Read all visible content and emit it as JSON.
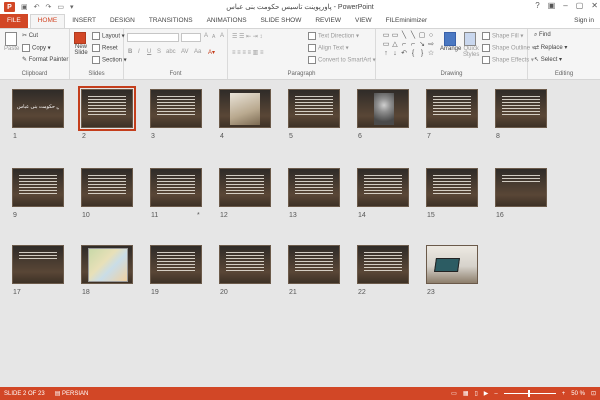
{
  "window": {
    "title": "پاورپوینت تاسیس حکومت بنی عباس - PowerPoint",
    "app_icon": "P",
    "controls": [
      "?",
      "▣",
      "–",
      "▢",
      "✕"
    ]
  },
  "ribbon_tabs": [
    {
      "label": "FILE"
    },
    {
      "label": "HOME"
    },
    {
      "label": "INSERT"
    },
    {
      "label": "DESIGN"
    },
    {
      "label": "TRANSITIONS"
    },
    {
      "label": "ANIMATIONS"
    },
    {
      "label": "SLIDE SHOW"
    },
    {
      "label": "REVIEW"
    },
    {
      "label": "VIEW"
    },
    {
      "label": "FILEminimizer"
    }
  ],
  "active_tab": "HOME",
  "sign_in": "Sign in",
  "clipboard": {
    "paste": "Paste",
    "cut": "Cut",
    "copy": "Copy",
    "format_painter": "Format Painter",
    "label": "Clipboard"
  },
  "slides_group": {
    "new_slide": "New",
    "new_slide2": "Slide",
    "layout": "Layout",
    "reset": "Reset",
    "section": "Section",
    "label": "Slides"
  },
  "font_group": {
    "label": "Font",
    "bold": "B",
    "italic": "I",
    "underline": "U",
    "strike": "S",
    "shadow": "abc",
    "spacing": "AV",
    "case": "Aa",
    "grow": "A",
    "shrink": "A",
    "clear": "A"
  },
  "paragraph_group": {
    "text_direction": "Text Direction",
    "align_text": "Align Text",
    "smartart": "Convert to SmartArt",
    "label": "Paragraph"
  },
  "drawing_group": {
    "arrange": "Arrange",
    "quick_styles": "Quick",
    "quick_styles2": "Styles",
    "shape_fill": "Shape Fill",
    "shape_outline": "Shape Outline",
    "shape_effects": "Shape Effects",
    "label": "Drawing",
    "shapes": [
      "▭",
      "▭",
      "╲",
      "╲",
      "▢",
      "○",
      "▭",
      "△",
      "⌐",
      "⌐",
      "↘",
      "⇨",
      "↑",
      "↓",
      "↶",
      "{",
      "}",
      "☆"
    ]
  },
  "editing_group": {
    "find": "Find",
    "replace": "Replace",
    "select": "Select",
    "label": "Editing"
  },
  "slides": [
    {
      "num": "1",
      "kind": "title",
      "title_text": "تاسیس حکومت بنی عباس"
    },
    {
      "num": "2",
      "kind": "text",
      "selected": true
    },
    {
      "num": "3",
      "kind": "text"
    },
    {
      "num": "4",
      "kind": "photo1"
    },
    {
      "num": "5",
      "kind": "text"
    },
    {
      "num": "6",
      "kind": "photo2"
    },
    {
      "num": "7",
      "kind": "text"
    },
    {
      "num": "8",
      "kind": "text"
    },
    {
      "num": "9",
      "kind": "text"
    },
    {
      "num": "10",
      "kind": "text"
    },
    {
      "num": "11",
      "kind": "text",
      "star": "*"
    },
    {
      "num": "12",
      "kind": "text"
    },
    {
      "num": "13",
      "kind": "text"
    },
    {
      "num": "14",
      "kind": "text"
    },
    {
      "num": "15",
      "kind": "text"
    },
    {
      "num": "16",
      "kind": "short"
    },
    {
      "num": "17",
      "kind": "short"
    },
    {
      "num": "18",
      "kind": "map"
    },
    {
      "num": "19",
      "kind": "text"
    },
    {
      "num": "20",
      "kind": "text"
    },
    {
      "num": "21",
      "kind": "text"
    },
    {
      "num": "22",
      "kind": "text"
    },
    {
      "num": "23",
      "kind": "laptop"
    }
  ],
  "status": {
    "slide_info": "SLIDE 2 OF 23",
    "language": "PERSIAN",
    "zoom": "50 %",
    "minus": "–",
    "plus": "+"
  }
}
